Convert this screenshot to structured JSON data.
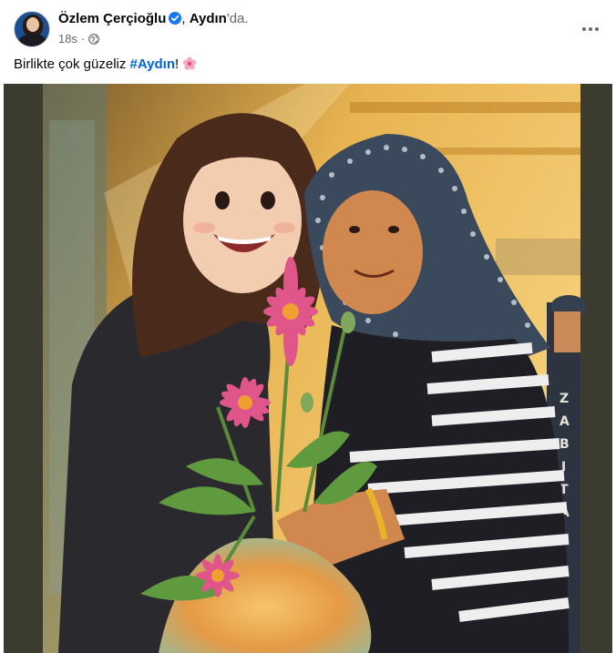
{
  "post": {
    "author": "Özlem Çerçioğlu",
    "location_prefix": ", ",
    "location": "Aydın",
    "location_suffix": "'da.",
    "time": "18s",
    "separator": "·",
    "caption_text": "Birlikte çok güzeliz ",
    "hashtag": "#Aydın",
    "caption_end": "!",
    "icons": {
      "verified": "verified-badge-icon",
      "audience": "globe-icon",
      "more": "more-options-icon",
      "emoji": "pink-flower-emoji"
    },
    "colors": {
      "hashtag": "#0064d1",
      "verified": "#1877f2",
      "meta": "#65676b"
    },
    "image": {
      "sign_text": "ZABITA"
    }
  }
}
